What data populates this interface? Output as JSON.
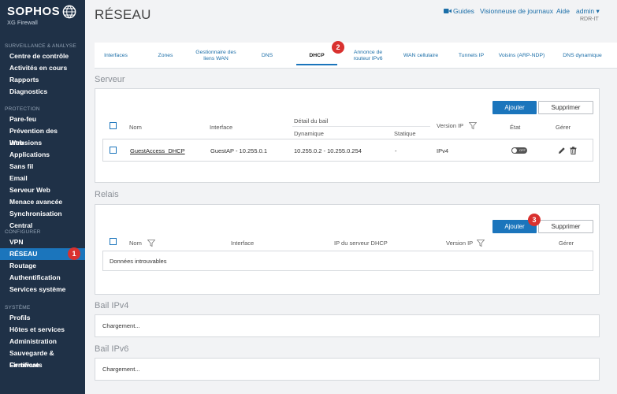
{
  "brand": {
    "name": "SOPHOS",
    "product": "XG Firewall"
  },
  "sidebar": {
    "sections": [
      {
        "title": "SURVEILLANCE & ANALYSE",
        "items": [
          "Centre de contrôle",
          "Activités en cours",
          "Rapports",
          "Diagnostics"
        ]
      },
      {
        "title": "PROTECTION",
        "items": [
          "Pare-feu",
          "Prévention des intrusions",
          "Web",
          "Applications",
          "Sans fil",
          "Email",
          "Serveur Web",
          "Menace avancée",
          "Synchronisation Central"
        ]
      },
      {
        "title": "CONFIGURER",
        "items": [
          "VPN",
          "RÉSEAU",
          "Routage",
          "Authentification",
          "Services système"
        ]
      },
      {
        "title": "SYSTÈME",
        "items": [
          "Profils",
          "Hôtes et services",
          "Administration",
          "Sauvegarde & Firmware",
          "Certificats"
        ]
      }
    ]
  },
  "header": {
    "title": "RÉSEAU",
    "guides": "Guides",
    "logs": "Visionneuse de journaux",
    "help": "Aide",
    "user": "admin ▾",
    "hostname": "RDR-IT"
  },
  "tabs": [
    "Interfaces",
    "Zones",
    "Gestionnaire des liens WAN",
    "DNS",
    "DHCP",
    "Annonce de routeur IPv6",
    "WAN cellulaire",
    "Tunnels IP",
    "Voisins (ARP-NDP)",
    "DNS dynamique"
  ],
  "server": {
    "title": "Serveur",
    "add": "Ajouter",
    "delete": "Supprimer",
    "headers": {
      "name": "Nom",
      "interface": "Interface",
      "lease": "Détail du bail",
      "dynamic": "Dynamique",
      "static": "Statique",
      "ipversion": "Version IP",
      "state": "État",
      "manage": "Gérer"
    },
    "rows": [
      {
        "name": "GuestAccess_DHCP",
        "interface": "GuestAP - 10.255.0.1",
        "dynamic": "10.255.0.2 - 10.255.0.254",
        "static": "-",
        "ipversion": "IPv4",
        "state": "OFF"
      }
    ]
  },
  "relay": {
    "title": "Relais",
    "add": "Ajouter",
    "delete": "Supprimer",
    "headers": {
      "name": "Nom",
      "interface": "Interface",
      "dhcp_ip": "IP du serveur DHCP",
      "ipversion": "Version IP",
      "manage": "Gérer"
    },
    "empty": "Données introuvables"
  },
  "lease4": {
    "title": "Bail IPv4",
    "loading": "Chargement..."
  },
  "lease6": {
    "title": "Bail IPv6",
    "loading": "Chargement..."
  },
  "badges": [
    "1",
    "2",
    "3"
  ],
  "colors": {
    "sidebar": "#1f3147",
    "accent": "#1b75bc",
    "badge": "#d9312f"
  }
}
